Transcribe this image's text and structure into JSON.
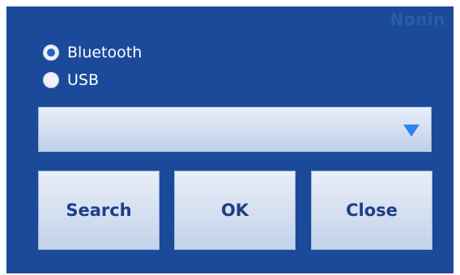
{
  "watermark": "Nonin",
  "connection": {
    "options": [
      {
        "label": "Bluetooth",
        "selected": true
      },
      {
        "label": "USB",
        "selected": false
      }
    ]
  },
  "device_select": {
    "value": "",
    "arrow_icon": "dropdown-triangle-icon",
    "arrow_color": "#2b86e8"
  },
  "buttons": {
    "search_label": "Search",
    "ok_label": "OK",
    "close_label": "Close"
  },
  "colors": {
    "dialog_background": "#1a4a99",
    "button_text": "#1c3f86"
  }
}
